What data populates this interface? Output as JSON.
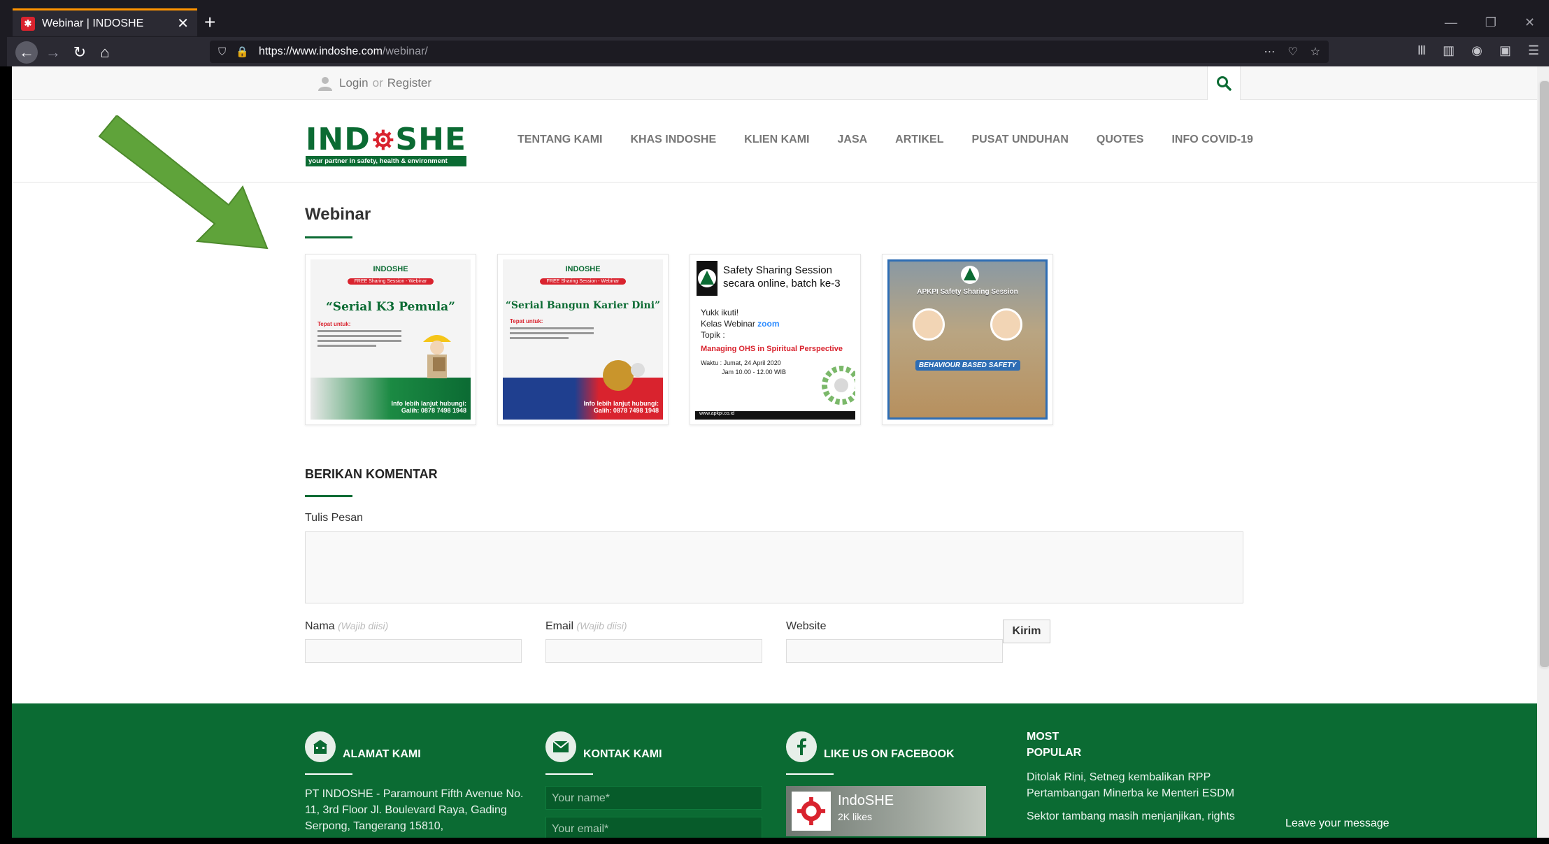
{
  "browser": {
    "tab_title": "Webinar | INDOSHE",
    "url_host": "https://www.indoshe.com",
    "url_path": "/webinar/",
    "new_tab": "+",
    "close": "✕"
  },
  "topbar": {
    "login": "Login",
    "or": "or",
    "register": "Register"
  },
  "logo": {
    "left": "IND",
    "right": "SHE",
    "tagline": "your partner in safety, health & environment"
  },
  "nav": [
    "TENTANG KAMI",
    "KHAS INDOSHE",
    "KLIEN KAMI",
    "JASA",
    "ARTIKEL",
    "PUSAT UNDUHAN",
    "QUOTES",
    "INFO COVID-19"
  ],
  "page_title": "Webinar",
  "gallery": {
    "poster1": {
      "logo": "INDOSHE",
      "badge": "FREE Sharing Session - Webinar",
      "title": "“Serial K3 Pemula”",
      "for": "Tepat untuk:",
      "info": "Info lebih lanjut hubungi: Galih: 0878 7498 1948"
    },
    "poster2": {
      "logo": "INDOSHE",
      "badge": "FREE Sharing Session - Webinar",
      "title": "“Serial Bangun Karier Dini”",
      "for": "Tepat untuk:",
      "info": "Info lebih lanjut hubungi: Galih: 0878 7498 1948"
    },
    "poster3": {
      "title": "Safety Sharing Session secara online, batch ke-3",
      "yukk": "Yukk ikuti!",
      "kelas": "Kelas Webinar",
      "zoom": "zoom",
      "topik": "Topik :",
      "topic": "Managing OHS in Spiritual Perspective",
      "waktu": "Waktu : Jumat, 24 April 2020",
      "jam": "Jam 10.00 - 12.00 WIB",
      "footer": "www.apkpi.co.id"
    },
    "poster4": {
      "title": "APKPI Safety Sharing Session",
      "banner": "BEHAVIOUR BASED SAFETY"
    }
  },
  "comment": {
    "heading": "BERIKAN KOMENTAR",
    "message_label": "Tulis Pesan",
    "name_label": "Nama",
    "name_hint": "(Wajib diisi)",
    "email_label": "Email",
    "email_hint": "(Wajib diisi)",
    "website_label": "Website",
    "submit": "Kirim"
  },
  "footer": {
    "address_title": "ALAMAT KAMI",
    "address_text": "PT INDOSHE - Paramount Fifth Avenue No. 11, 3rd Floor Jl. Boulevard Raya, Gading Serpong, Tangerang 15810,",
    "contact_title": "KONTAK KAMI",
    "name_placeholder": "Your name*",
    "email_placeholder": "Your email*",
    "facebook_title": "LIKE US ON FACEBOOK",
    "fb_name": "IndoSHE",
    "fb_likes": "2K likes",
    "popular_title_1": "MOST",
    "popular_title_2": "POPULAR",
    "popular_1": "Ditolak Rini, Setneg kembalikan RPP Pertambangan Minerba ke Menteri ESDM",
    "popular_2": "Sektor tambang masih menjanjikan, rights"
  },
  "chat": "Leave your message",
  "colors": {
    "brand_green": "#0b6b33",
    "arrow_green": "#5fa33a",
    "accent_red": "#d9232e"
  }
}
